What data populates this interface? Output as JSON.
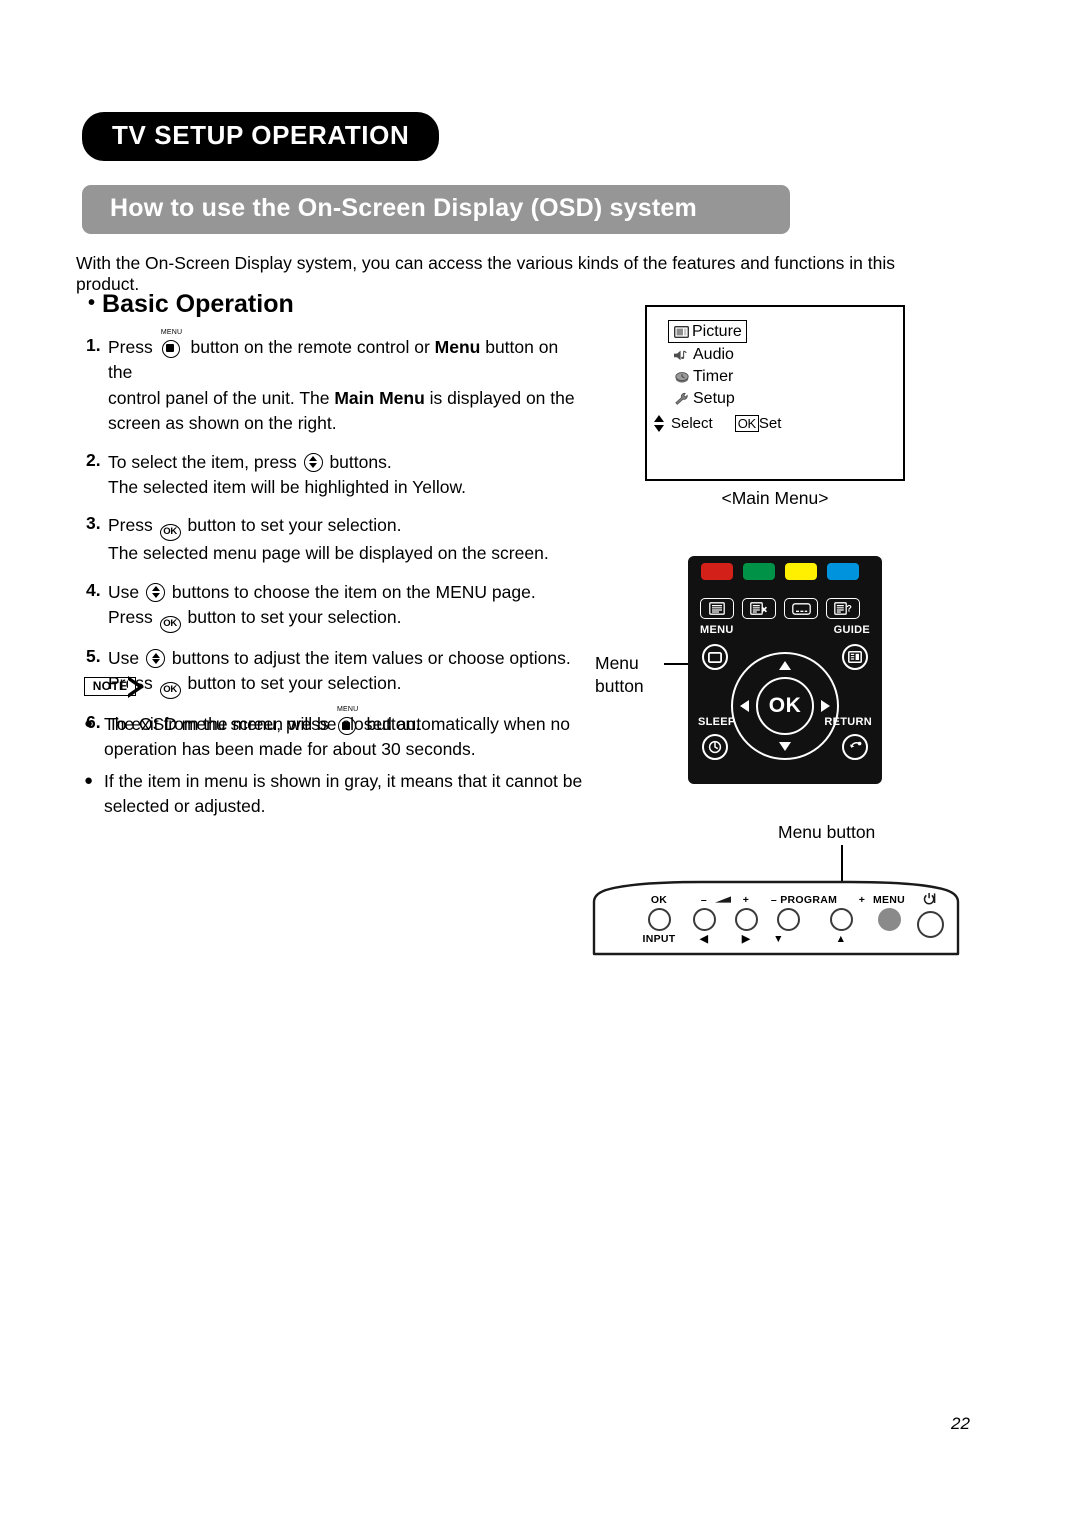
{
  "chapter": {
    "title": "TV SETUP OPERATION"
  },
  "section": {
    "title": "How to use the On-Screen Display (OSD) system"
  },
  "intro": "With the On-Screen Display system, you can access the various kinds of the features and functions in this product.",
  "subsection": {
    "bullet": "•",
    "title": "Basic Operation"
  },
  "steps": [
    {
      "num": "1.",
      "pre": "Press",
      "icon": "menu-icon",
      "post": "button on the remote control or ",
      "bold1": "Menu",
      "post2": " button on the",
      "line2_pre": "control panel of the unit. The ",
      "line2_bold": "Main Menu",
      "line2_post": " is displayed on the",
      "line3": "screen as shown on the right."
    },
    {
      "num": "2.",
      "pre": "To select the item, press",
      "icon": "up-down-icon",
      "post": "buttons.",
      "line2": "The selected item will be highlighted in Yellow."
    },
    {
      "num": "3.",
      "pre": "Press",
      "icon": "ok-icon",
      "post": "button to set your selection.",
      "line2": "The selected menu page will be displayed on the screen."
    },
    {
      "num": "4.",
      "pre": "Use",
      "icon": "up-down-icon",
      "post": "buttons to choose the item on the MENU page.",
      "line2_pre": "Press",
      "line2_icon": "ok-icon",
      "line2_post": "button to set your selection."
    },
    {
      "num": "5.",
      "pre": "Use",
      "icon": "up-down-icon",
      "post": "buttons to adjust the item values or choose options.",
      "line2_pre": "Press",
      "line2_icon": "ok-icon",
      "line2_post": "button to set your selection."
    },
    {
      "num": "6.",
      "pre": "To exit from the menu, press",
      "icon": "menu-icon",
      "post": "button."
    }
  ],
  "note": {
    "tag": "NOTE",
    "bullet": "●",
    "items": [
      "The OSD menu screen will be closed automatically when no operation has been made for about 30 seconds.",
      "If the item in menu is shown in gray, it means that it cannot be selected or adjusted."
    ]
  },
  "osd": {
    "caption": "<Main Menu>",
    "items": [
      {
        "label": "Picture",
        "icon": "tv-screen-icon",
        "selected": true
      },
      {
        "label": "Audio",
        "icon": "speaker-note-icon",
        "selected": false
      },
      {
        "label": "Timer",
        "icon": "clock-icon",
        "selected": false
      },
      {
        "label": "Setup",
        "icon": "wrench-icon",
        "selected": false
      }
    ],
    "footer": {
      "select_label": "Select",
      "ok_label": "OK",
      "set_label": "Set"
    }
  },
  "remote": {
    "callout_line1": "Menu",
    "callout_line2": "button",
    "color_buttons": [
      {
        "name": "red-button",
        "color": "#D32019"
      },
      {
        "name": "green-button",
        "color": "#009247"
      },
      {
        "name": "yellow-button",
        "color": "#FFF000"
      },
      {
        "name": "blue-button",
        "color": "#0093DD"
      }
    ],
    "teletext_buttons": [
      {
        "name": "teletext-text-icon"
      },
      {
        "name": "teletext-cancel-icon"
      },
      {
        "name": "subtitle-icon"
      },
      {
        "name": "teletext-reveal-icon"
      }
    ],
    "menu_label": "MENU",
    "guide_label": "GUIDE",
    "sleep_label": "SLEEP",
    "return_label": "RETURN",
    "ok_label": "OK"
  },
  "control_panel": {
    "callout": "Menu button",
    "buttons": [
      {
        "top": "OK",
        "bottom": "INPUT",
        "name": "ok-input-button"
      },
      {
        "top": "–",
        "bottom": "◀",
        "name": "volume-down-button"
      },
      {
        "top": "+",
        "bottom": "▶",
        "name": "volume-up-button"
      },
      {
        "top": "– PROGRAM",
        "bottom": "▼",
        "name": "program-down-button"
      },
      {
        "top": "+",
        "bottom": "▲",
        "name": "program-up-button"
      },
      {
        "top": "MENU",
        "bottom": "",
        "name": "menu-button"
      },
      {
        "top": "",
        "bottom": "",
        "name": "power-button"
      }
    ]
  },
  "page_number": "22"
}
